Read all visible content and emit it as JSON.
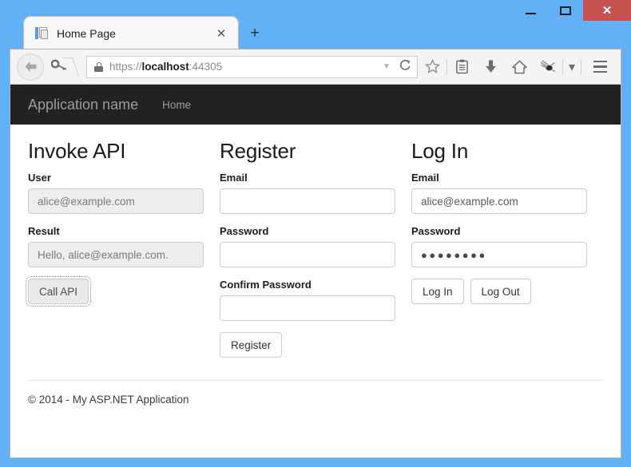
{
  "window": {
    "controls": {
      "minimize": "—",
      "maximize": "",
      "close": "✕"
    }
  },
  "browser": {
    "tab": {
      "title": "Home Page",
      "close_label": "✕",
      "favicon": "page-icon"
    },
    "new_tab_label": "+",
    "back_label": "←",
    "identity_key": "🗝",
    "url": {
      "scheme": "https://",
      "host": "localhost",
      "port": ":44305",
      "full": "https://localhost:44305"
    },
    "url_dropdown": "▼",
    "reload": "⟳",
    "toolbar_icons": [
      {
        "name": "bookmark-star-icon",
        "glyph": "☆"
      },
      {
        "name": "reading-list-icon",
        "glyph": "Ὄb"
      },
      {
        "name": "download-icon",
        "glyph": "⬇"
      },
      {
        "name": "home-icon",
        "glyph": "⌂"
      },
      {
        "name": "pocket-icon",
        "glyph": "❁"
      }
    ],
    "overflow_caret": "▾",
    "menu_label": "menu"
  },
  "nav": {
    "brand": "Application name",
    "links": [
      {
        "label": "Home"
      }
    ]
  },
  "columns": [
    {
      "id": "invoke-api",
      "heading": "Invoke API",
      "fields": [
        {
          "id": "user",
          "label": "User",
          "value": "alice@example.com",
          "readonly": true,
          "masked": false
        },
        {
          "id": "result",
          "label": "Result",
          "value": "Hello, alice@example.com.",
          "readonly": true,
          "masked": false
        }
      ],
      "buttons": [
        {
          "id": "call-api",
          "label": "Call API",
          "focused": true
        }
      ]
    },
    {
      "id": "register",
      "heading": "Register",
      "fields": [
        {
          "id": "register-email",
          "label": "Email",
          "value": "",
          "readonly": false,
          "masked": false
        },
        {
          "id": "register-password",
          "label": "Password",
          "value": "",
          "readonly": false,
          "masked": false
        },
        {
          "id": "register-confirm-password",
          "label": "Confirm Password",
          "value": "",
          "readonly": false,
          "masked": false
        }
      ],
      "buttons": [
        {
          "id": "register",
          "label": "Register",
          "focused": false
        }
      ]
    },
    {
      "id": "log-in",
      "heading": "Log In",
      "fields": [
        {
          "id": "login-email",
          "label": "Email",
          "value": "alice@example.com",
          "readonly": false,
          "masked": false
        },
        {
          "id": "login-password",
          "label": "Password",
          "value": "●●●●●●●●",
          "readonly": false,
          "masked": true
        }
      ],
      "buttons": [
        {
          "id": "log-in",
          "label": "Log In",
          "focused": false
        },
        {
          "id": "log-out",
          "label": "Log Out",
          "focused": false
        }
      ]
    }
  ],
  "footer": {
    "text": "© 2014 - My ASP.NET Application"
  },
  "colors": {
    "window_frame": "#62b0f6",
    "navbar": "#222222",
    "close_button": "#c75050",
    "readonly_field": "#eeeeee"
  }
}
